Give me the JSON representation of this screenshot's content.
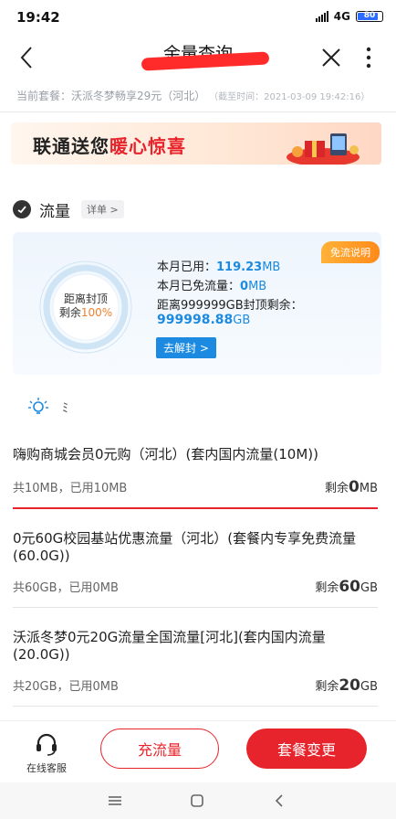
{
  "status": {
    "time": "19:42",
    "network": "4G",
    "battery": "80"
  },
  "nav": {
    "title": "余量查询"
  },
  "plan": {
    "label": "当前套餐：沃派冬梦畅享29元（河北）",
    "time_note": "（截至时间：2021-03-09 19:42:16）"
  },
  "banner": {
    "text_a": "联通送您",
    "text_b": "暖心惊喜"
  },
  "flow": {
    "title": "流量",
    "detail_label": "详单 >",
    "ring_text_1": "距离封顶",
    "ring_text_2": "剩余",
    "ring_pct": "100%",
    "ring_fraction": 1.0,
    "used_label": "本月已用：",
    "used_value": "119.23",
    "used_unit": "MB",
    "free_label": "本月已免流量：",
    "free_value": "0",
    "free_unit": "MB",
    "cap_label": "距离999999GB封顶剩余：",
    "cap_value": "999998.88",
    "cap_unit": "GB",
    "unlock_label": "去解封 >",
    "free_explain": "免流说明"
  },
  "tip": {
    "symbol": "ﾐ"
  },
  "items": [
    {
      "name": "嗨购商城会员0元购（河北）(套内国内流量(10M))",
      "used": "共10MB，已用10MB",
      "remain_label": "剩余",
      "remain_value": "0",
      "remain_unit": "MB"
    },
    {
      "name": "0元60G校园基站优惠流量（河北）(套餐内专享免费流量(60.0G))",
      "used": "共60GB，已用0MB",
      "remain_label": "剩余",
      "remain_value": "60",
      "remain_unit": "GB"
    },
    {
      "name": "沃派冬梦0元20G流量全国流量[河北](套内国内流量(20.0G))",
      "used": "共20GB，已用0MB",
      "remain_label": "剩余",
      "remain_value": "20",
      "remain_unit": "GB"
    }
  ],
  "bottom": {
    "service_label": "在线客服",
    "recharge_label": "充流量",
    "change_label": "套餐变更"
  },
  "colors": {
    "accent": "#e7242c",
    "blue": "#1b8ae0",
    "orange": "#f08030"
  }
}
